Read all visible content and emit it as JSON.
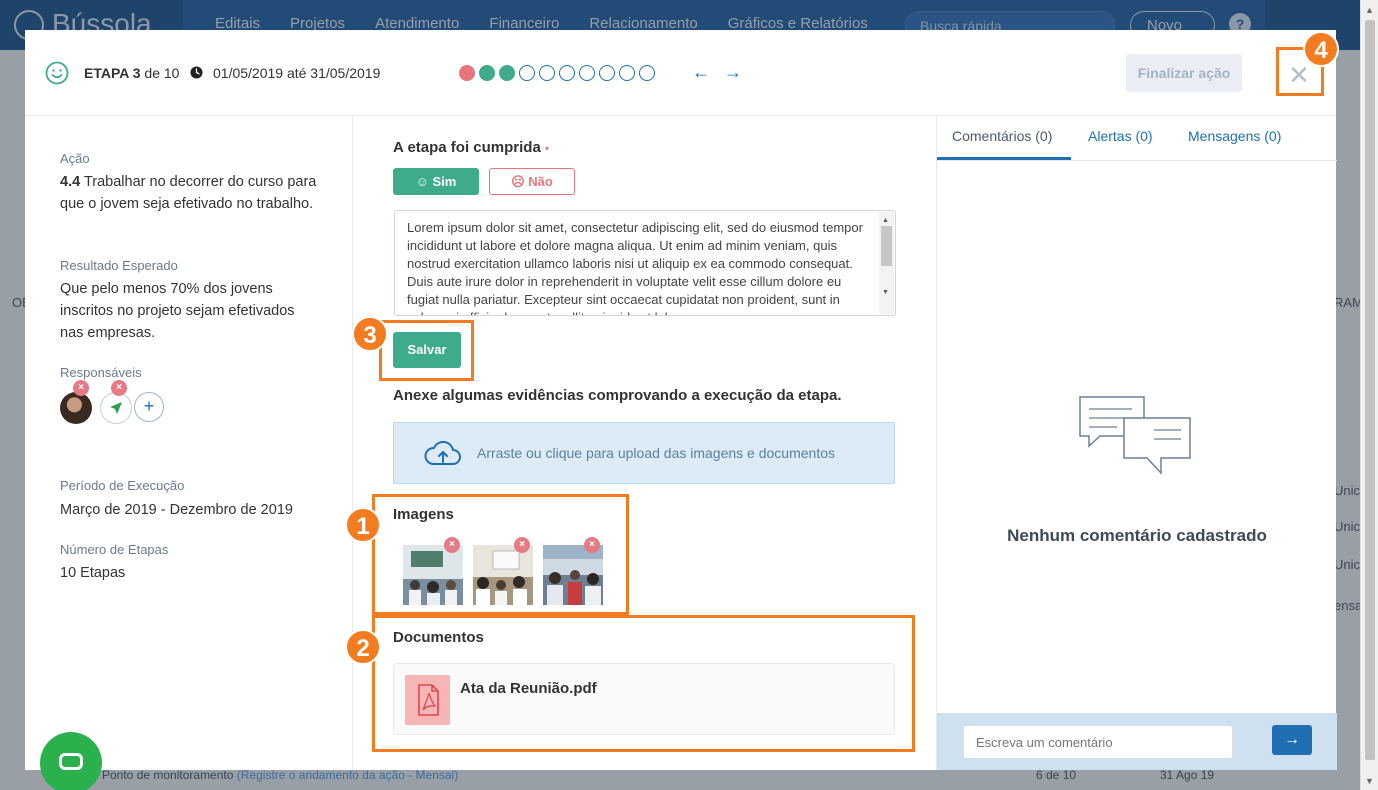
{
  "app": {
    "logo": "Bússola",
    "nav": [
      "Editais",
      "Projetos",
      "Atendimento",
      "Financeiro",
      "Relacionamento",
      "Gráficos e Relatórios"
    ],
    "search_placeholder": "Busca rápida",
    "new_button": "Novo",
    "help": "?",
    "bg_rows": [
      "Unico",
      "Unico",
      "Unico",
      "ensal",
      "---",
      "---",
      "---"
    ],
    "bg_header_right": "RAM",
    "bg_header_left": "OB",
    "footer_row": {
      "title": "Ponto de monitoramento",
      "link": "(Registre o andamento da ação - Mensal)",
      "count": "6 de 10",
      "date": "31 Ago 19"
    }
  },
  "modal": {
    "header": {
      "etapa_label": "ETAPA 3",
      "etapa_of": "de 10",
      "period": "01/05/2019 até 31/05/2019",
      "progress_dots": [
        "red",
        "green",
        "green",
        "empty",
        "empty",
        "empty",
        "empty",
        "empty",
        "empty",
        "empty"
      ],
      "prev_arrow": "←",
      "next_arrow": "→",
      "finalize_button": "Finalizar ação",
      "close": "✕"
    },
    "left": {
      "acao_label": "Ação",
      "acao_number": "4.4",
      "acao_text": "Trabalhar no decorrer do curso para que o jovem seja efetivado no trabalho.",
      "resultado_label": "Resultado Esperado",
      "resultado_text": "Que pelo menos 70% dos jovens inscritos no projeto sejam efetivados nas empresas.",
      "responsaveis_label": "Responsáveis",
      "add_responsavel": "+",
      "periodo_label": "Período de Execução",
      "periodo_text": "Março de 2019 - Dezembro de 2019",
      "etapas_label": "Número de Etapas",
      "etapas_text": "10 Etapas"
    },
    "center": {
      "question": "A etapa foi cumprida",
      "required_mark": "•",
      "yes_button": "☺ Sim",
      "no_button": "☹ Não",
      "comment_text": "Lorem ipsum dolor sit amet, consectetur adipiscing elit, sed do eiusmod tempor incididunt ut labore et dolore magna aliqua. Ut enim ad minim veniam, quis nostrud exercitation ullamco laboris nisi ut aliquip ex ea commodo consequat. Duis aute irure dolor in reprehenderit in voluptate velit esse cillum dolore eu fugiat nulla pariatur. Excepteur sint occaecat cupidatat non proident, sunt in culpa qui officia deserunt mollit anim id est laborum.",
      "save_button": "Salvar",
      "evidence_prompt": "Anexe algumas evidências comprovando a execução da etapa.",
      "upload_text": "Arraste ou clique para upload das imagens e documentos",
      "images_title": "Imagens",
      "documents_title": "Documentos",
      "document_name": "Ata da Reunião.pdf",
      "remove_mark": "×"
    },
    "right": {
      "tabs": [
        "Comentários (0)",
        "Alertas (0)",
        "Mensagens (0)"
      ],
      "empty_message": "Nenhum comentário cadastrado",
      "comment_placeholder": "Escreva um comentário",
      "send": "→"
    }
  },
  "callouts": [
    "1",
    "2",
    "3",
    "4"
  ],
  "colors": {
    "primary": "#1f6fb2",
    "success": "#3dab8c",
    "danger": "#e8757d",
    "highlight": "#f47c20"
  }
}
